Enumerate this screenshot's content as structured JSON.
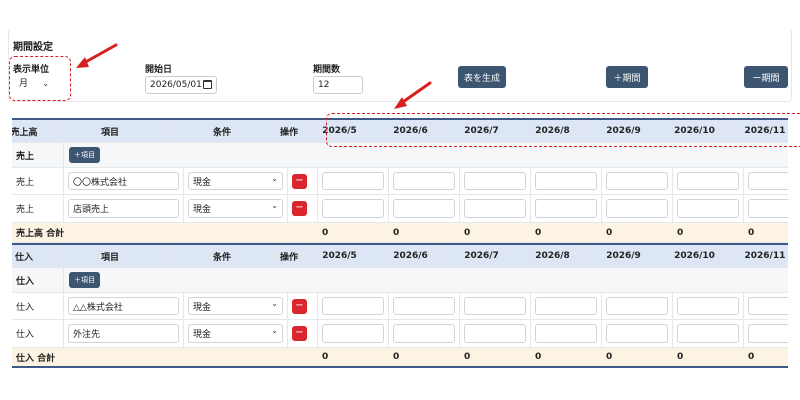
{
  "settings": {
    "title": "期間設定",
    "unit_label": "表示単位",
    "unit_value": "月",
    "start_label": "開始日",
    "start_value": "2026/05/01",
    "count_label": "期間数",
    "count_value": "12",
    "generate_button": "表を生成",
    "add_period_button": "＋期間",
    "remove_period_button": "ー期間"
  },
  "columns": {
    "item": "項目",
    "condition": "条件",
    "action": "操作",
    "periods": [
      "2026/5",
      "2026/6",
      "2026/7",
      "2026/8",
      "2026/9",
      "2026/10",
      "2026/11"
    ]
  },
  "sales": {
    "header": "売上高",
    "section_label": "売上",
    "add_item_button": "＋項目",
    "rows": [
      {
        "category": "売上",
        "item": "〇〇株式会社",
        "condition": "現金",
        "delete": "−"
      },
      {
        "category": "売上",
        "item": "店頭売上",
        "condition": "現金",
        "delete": "−"
      }
    ],
    "total_label": "売上高 合計",
    "totals": [
      "0",
      "0",
      "0",
      "0",
      "0",
      "0",
      "0"
    ]
  },
  "purchase": {
    "header": "仕入",
    "section_label": "仕入",
    "add_item_button": "＋項目",
    "rows": [
      {
        "category": "仕入",
        "item": "△△株式会社",
        "condition": "現金",
        "delete": "−"
      },
      {
        "category": "仕入",
        "item": "外注先",
        "condition": "現金",
        "delete": "−"
      }
    ],
    "total_label": "仕入 合計",
    "totals": [
      "0",
      "0",
      "0",
      "0",
      "0",
      "0",
      "0"
    ]
  },
  "colors": {
    "annotation": "#d62020",
    "header_bg": "#dce6f4",
    "button": "#3c5570",
    "delete": "#d9262c",
    "total_bg": "#fdf3e3"
  }
}
